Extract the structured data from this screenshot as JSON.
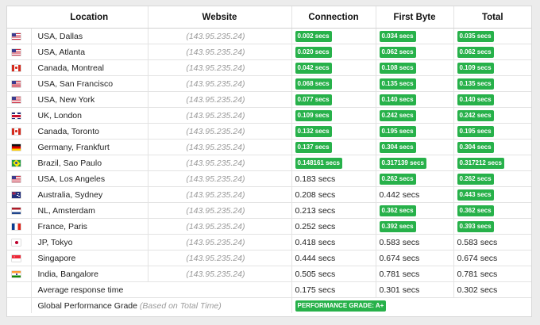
{
  "headers": {
    "location": "Location",
    "website": "Website",
    "connection": "Connection",
    "first_byte": "First Byte",
    "total": "Total"
  },
  "colors": {
    "badge_green": "#27b14a",
    "ip_gray": "#9a9a9a"
  },
  "rows": [
    {
      "flag": "us-flag-icon",
      "location": "USA, Dallas",
      "website": "(143.95.235.24)",
      "connection": "0.002 secs",
      "connection_badge": true,
      "first_byte": "0.034 secs",
      "first_byte_badge": true,
      "total": "0.035 secs",
      "total_badge": true
    },
    {
      "flag": "us-flag-icon",
      "location": "USA, Atlanta",
      "website": "(143.95.235.24)",
      "connection": "0.020 secs",
      "connection_badge": true,
      "first_byte": "0.062 secs",
      "first_byte_badge": true,
      "total": "0.062 secs",
      "total_badge": true
    },
    {
      "flag": "ca-flag-icon",
      "location": "Canada, Montreal",
      "website": "(143.95.235.24)",
      "connection": "0.042 secs",
      "connection_badge": true,
      "first_byte": "0.108 secs",
      "first_byte_badge": true,
      "total": "0.109 secs",
      "total_badge": true
    },
    {
      "flag": "us-flag-icon",
      "location": "USA, San Francisco",
      "website": "(143.95.235.24)",
      "connection": "0.068 secs",
      "connection_badge": true,
      "first_byte": "0.135 secs",
      "first_byte_badge": true,
      "total": "0.135 secs",
      "total_badge": true
    },
    {
      "flag": "us-flag-icon",
      "location": "USA, New York",
      "website": "(143.95.235.24)",
      "connection": "0.077 secs",
      "connection_badge": true,
      "first_byte": "0.140 secs",
      "first_byte_badge": true,
      "total": "0.140 secs",
      "total_badge": true
    },
    {
      "flag": "uk-flag-icon",
      "location": "UK, London",
      "website": "(143.95.235.24)",
      "connection": "0.109 secs",
      "connection_badge": true,
      "first_byte": "0.242 secs",
      "first_byte_badge": true,
      "total": "0.242 secs",
      "total_badge": true
    },
    {
      "flag": "ca-flag-icon",
      "location": "Canada, Toronto",
      "website": "(143.95.235.24)",
      "connection": "0.132 secs",
      "connection_badge": true,
      "first_byte": "0.195 secs",
      "first_byte_badge": true,
      "total": "0.195 secs",
      "total_badge": true
    },
    {
      "flag": "de-flag-icon",
      "location": "Germany, Frankfurt",
      "website": "(143.95.235.24)",
      "connection": "0.137 secs",
      "connection_badge": true,
      "first_byte": "0.304 secs",
      "first_byte_badge": true,
      "total": "0.304 secs",
      "total_badge": true
    },
    {
      "flag": "br-flag-icon",
      "location": "Brazil, Sao Paulo",
      "website": "(143.95.235.24)",
      "connection": "0.148161 secs",
      "connection_badge": true,
      "first_byte": "0.317139 secs",
      "first_byte_badge": true,
      "total": "0.317212 secs",
      "total_badge": true
    },
    {
      "flag": "us-flag-icon",
      "location": "USA, Los Angeles",
      "website": "(143.95.235.24)",
      "connection": "0.183 secs",
      "connection_badge": false,
      "first_byte": "0.262 secs",
      "first_byte_badge": true,
      "total": "0.262 secs",
      "total_badge": true
    },
    {
      "flag": "au-flag-icon",
      "location": "Australia, Sydney",
      "website": "(143.95.235.24)",
      "connection": "0.208 secs",
      "connection_badge": false,
      "first_byte": "0.442 secs",
      "first_byte_badge": false,
      "total": "0.443 secs",
      "total_badge": true
    },
    {
      "flag": "nl-flag-icon",
      "location": "NL, Amsterdam",
      "website": "(143.95.235.24)",
      "connection": "0.213 secs",
      "connection_badge": false,
      "first_byte": "0.362 secs",
      "first_byte_badge": true,
      "total": "0.362 secs",
      "total_badge": true
    },
    {
      "flag": "fr-flag-icon",
      "location": "France, Paris",
      "website": "(143.95.235.24)",
      "connection": "0.252 secs",
      "connection_badge": false,
      "first_byte": "0.392 secs",
      "first_byte_badge": true,
      "total": "0.393 secs",
      "total_badge": true
    },
    {
      "flag": "jp-flag-icon",
      "location": "JP, Tokyo",
      "website": "(143.95.235.24)",
      "connection": "0.418 secs",
      "connection_badge": false,
      "first_byte": "0.583 secs",
      "first_byte_badge": false,
      "total": "0.583 secs",
      "total_badge": false
    },
    {
      "flag": "sg-flag-icon",
      "location": "Singapore",
      "website": "(143.95.235.24)",
      "connection": "0.444 secs",
      "connection_badge": false,
      "first_byte": "0.674 secs",
      "first_byte_badge": false,
      "total": "0.674 secs",
      "total_badge": false
    },
    {
      "flag": "in-flag-icon",
      "location": "India, Bangalore",
      "website": "(143.95.235.24)",
      "connection": "0.505 secs",
      "connection_badge": false,
      "first_byte": "0.781 secs",
      "first_byte_badge": false,
      "total": "0.781 secs",
      "total_badge": false
    }
  ],
  "average": {
    "label": "Average response time",
    "connection": "0.175 secs",
    "first_byte": "0.301 secs",
    "total": "0.302 secs"
  },
  "grade": {
    "label": "Global Performance Grade",
    "note": "(Based on Total Time)",
    "badge": "PERFORMANCE GRADE: A+"
  }
}
